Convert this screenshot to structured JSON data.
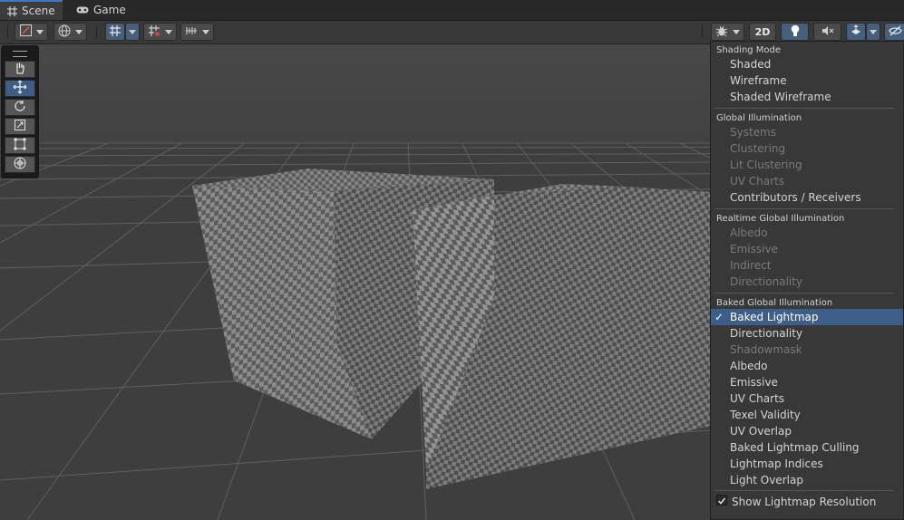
{
  "tabs": [
    {
      "label": "Scene",
      "icon": "grid-icon"
    },
    {
      "label": "Game",
      "icon": "gamepad-icon"
    }
  ],
  "toolbar": {
    "mode_2d": "2D"
  },
  "dropdown": {
    "sections": [
      {
        "header": "Shading Mode",
        "items": [
          {
            "label": "Shaded",
            "enabled": true
          },
          {
            "label": "Wireframe",
            "enabled": true
          },
          {
            "label": "Shaded Wireframe",
            "enabled": true
          }
        ]
      },
      {
        "header": "Global Illumination",
        "items": [
          {
            "label": "Systems",
            "enabled": false
          },
          {
            "label": "Clustering",
            "enabled": false
          },
          {
            "label": "Lit Clustering",
            "enabled": false
          },
          {
            "label": "UV Charts",
            "enabled": false
          },
          {
            "label": "Contributors / Receivers",
            "enabled": true
          }
        ]
      },
      {
        "header": "Realtime Global Illumination",
        "items": [
          {
            "label": "Albedo",
            "enabled": false
          },
          {
            "label": "Emissive",
            "enabled": false
          },
          {
            "label": "Indirect",
            "enabled": false
          },
          {
            "label": "Directionality",
            "enabled": false
          }
        ]
      },
      {
        "header": "Baked Global Illumination",
        "items": [
          {
            "label": "Baked Lightmap",
            "enabled": true,
            "selected": true
          },
          {
            "label": "Directionality",
            "enabled": true
          },
          {
            "label": "Shadowmask",
            "enabled": false
          },
          {
            "label": "Albedo",
            "enabled": true
          },
          {
            "label": "Emissive",
            "enabled": true
          },
          {
            "label": "UV Charts",
            "enabled": true
          },
          {
            "label": "Texel Validity",
            "enabled": true
          },
          {
            "label": "UV Overlap",
            "enabled": true
          },
          {
            "label": "Baked Lightmap Culling",
            "enabled": true
          },
          {
            "label": "Lightmap Indices",
            "enabled": true
          },
          {
            "label": "Light Overlap",
            "enabled": true
          }
        ]
      }
    ],
    "footer_toggle": {
      "label": "Show Lightmap Resolution",
      "checked": true
    }
  },
  "colors": {
    "accent": "#3e5e8a",
    "background": "#3f3f3f",
    "menu": "#383838"
  }
}
